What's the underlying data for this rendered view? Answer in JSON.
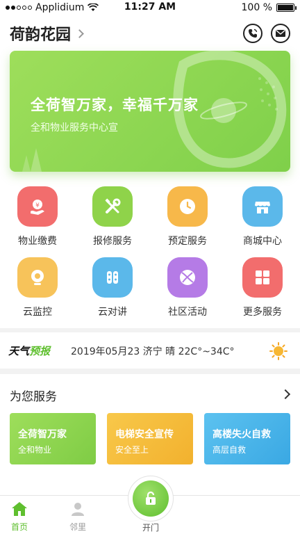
{
  "status_bar": {
    "carrier": "Applidium",
    "time": "11:27 AM",
    "battery": "100 %"
  },
  "header": {
    "title": "荷韵花园",
    "icons": [
      "phone-icon",
      "mail-icon"
    ]
  },
  "banner": {
    "headline": "全荷智万家，幸福千万家",
    "subtitle": "全和物业服务中心宣"
  },
  "services": [
    {
      "label": "物业缴费",
      "icon": "payment-icon",
      "color": "#f26d6d"
    },
    {
      "label": "报修服务",
      "icon": "repair-icon",
      "color": "#8fd34a"
    },
    {
      "label": "预定服务",
      "icon": "clock-icon",
      "color": "#f7b84a"
    },
    {
      "label": "商城中心",
      "icon": "store-icon",
      "color": "#5bb8ea"
    },
    {
      "label": "云监控",
      "icon": "camera-icon",
      "color": "#f7c35a"
    },
    {
      "label": "云对讲",
      "icon": "intercom-icon",
      "color": "#5bb8ea"
    },
    {
      "label": "社区活动",
      "icon": "ball-icon",
      "color": "#b57be6"
    },
    {
      "label": "更多服务",
      "icon": "grid-icon",
      "color": "#f26d6d"
    }
  ],
  "weather": {
    "logo_part1": "天气",
    "logo_part2": "预报",
    "text": "2019年05月23  济宁  晴  22C°~34C°"
  },
  "for_you": {
    "title": "为您服务",
    "cards": [
      {
        "title": "全荷智万家",
        "sub": "全和物业",
        "color": "#8fd34a"
      },
      {
        "title": "电梯安全宣传",
        "sub": "安全至上",
        "color": "#f5be3c"
      },
      {
        "title": "高楼失火自救",
        "sub": "高层自救",
        "color": "#4eb8ec"
      }
    ]
  },
  "tabbar": {
    "home": "首页",
    "neighbors": "邻里",
    "open_door": "开门"
  }
}
